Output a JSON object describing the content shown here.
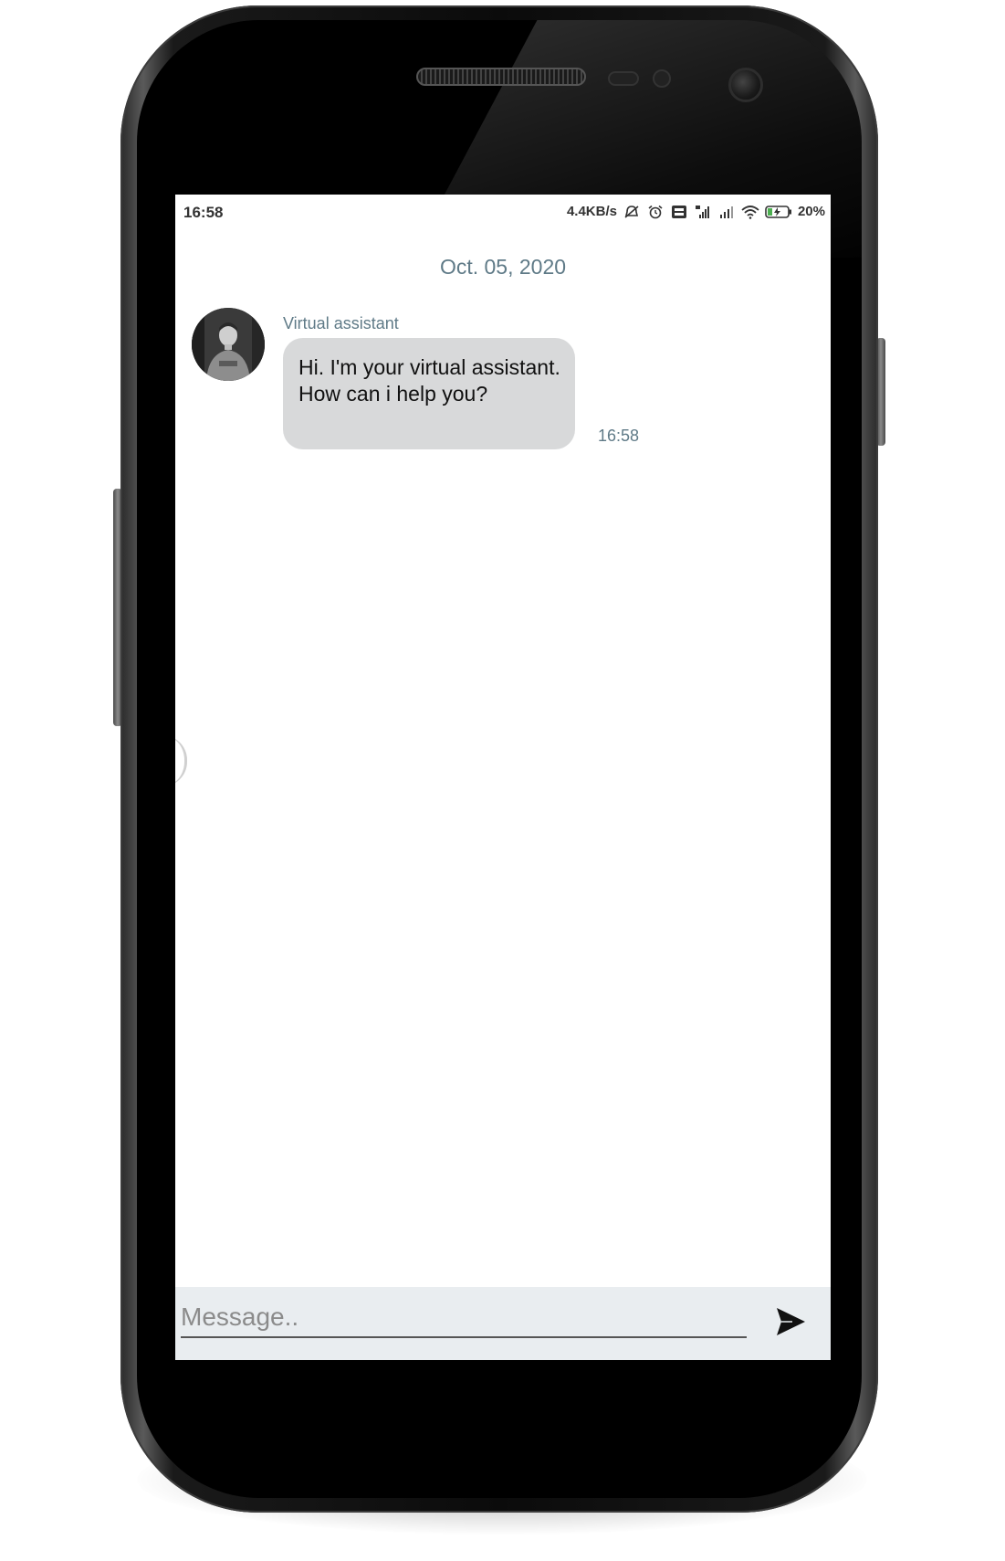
{
  "status_bar": {
    "time": "16:58",
    "network_speed": "4.4KB/s",
    "battery_percent": "20%",
    "icons": [
      "muted-bell-icon",
      "alarm-icon",
      "volte-icon",
      "4g-signal-icon",
      "signal-icon",
      "wifi-icon",
      "battery-charging-icon"
    ],
    "battery_level": 0.2,
    "battery_color": "#4caf50"
  },
  "chat": {
    "date_separator": "Oct. 05, 2020",
    "messages": [
      {
        "sender": "Virtual assistant",
        "text": "Hi. I'm your virtual assistant. How can i help you?",
        "time": "16:58",
        "avatar_icon": "person-avatar-icon"
      }
    ]
  },
  "composer": {
    "placeholder": "Message..",
    "value": "",
    "send_icon": "send-icon"
  },
  "colors": {
    "meta_text": "#5f7a87",
    "bubble_bg": "#d8d9da",
    "composer_bg": "#e9edf0"
  }
}
